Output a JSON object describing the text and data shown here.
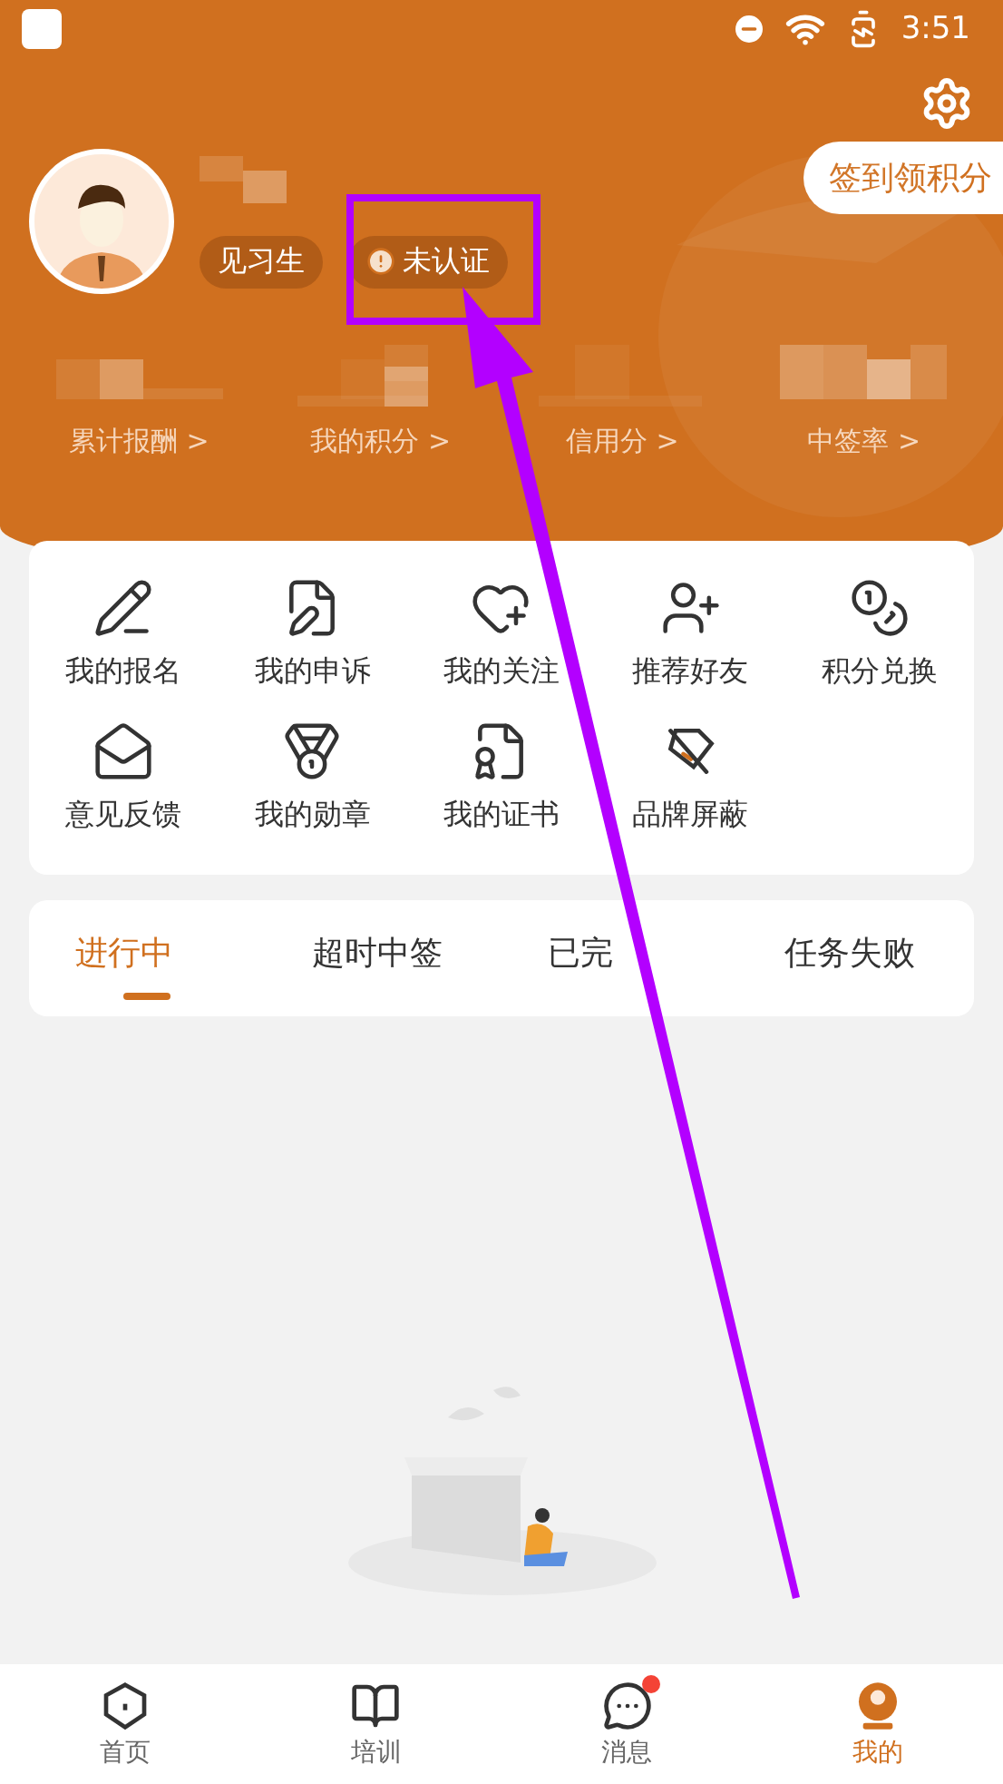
{
  "status_bar": {
    "time": "3:51"
  },
  "profile": {
    "role_badge": "见习生",
    "verify_badge": "未认证",
    "sign_in_button": "签到领积分"
  },
  "stats": [
    {
      "label": "累计报酬 >"
    },
    {
      "label": "我的积分 >"
    },
    {
      "label": "信用分 >"
    },
    {
      "label": "中签率 >"
    }
  ],
  "menu": [
    {
      "label": "我的报名"
    },
    {
      "label": "我的申诉"
    },
    {
      "label": "我的关注"
    },
    {
      "label": "推荐好友"
    },
    {
      "label": "积分兑换"
    },
    {
      "label": "意见反馈"
    },
    {
      "label": "我的勋章"
    },
    {
      "label": "我的证书"
    },
    {
      "label": "品牌屏蔽"
    }
  ],
  "tabs": [
    {
      "label": "进行中",
      "selected": true
    },
    {
      "label": "超时中签",
      "selected": false
    },
    {
      "label": "已完",
      "selected": false
    },
    {
      "label": "任务失败",
      "selected": false
    }
  ],
  "bottom_nav": [
    {
      "label": "首页",
      "selected": false,
      "unread": false
    },
    {
      "label": "培训",
      "selected": false,
      "unread": false
    },
    {
      "label": "消息",
      "selected": false,
      "unread": true
    },
    {
      "label": "我的",
      "selected": true,
      "unread": false
    }
  ]
}
